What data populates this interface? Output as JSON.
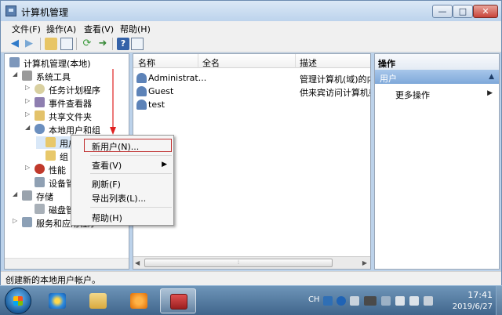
{
  "window": {
    "title": "计算机管理"
  },
  "window_controls": {
    "minimize": "—",
    "maximize": "□",
    "close": "✕"
  },
  "menu": [
    "文件(F)",
    "操作(A)",
    "查看(V)",
    "帮助(H)"
  ],
  "tree": {
    "items": [
      {
        "label": "计算机管理(本地)",
        "icon": "computer-management-icon"
      },
      {
        "label": "系统工具",
        "icon": "tools-icon"
      },
      {
        "label": "任务计划程序",
        "icon": "clock-icon"
      },
      {
        "label": "事件查看器",
        "icon": "event-viewer-icon"
      },
      {
        "label": "共享文件夹",
        "icon": "shared-folder-icon"
      },
      {
        "label": "本地用户和组",
        "icon": "users-group-icon"
      },
      {
        "label": "用户",
        "icon": "folder-icon"
      },
      {
        "label": "组",
        "icon": "folder-icon"
      },
      {
        "label": "性能",
        "icon": "performance-icon"
      },
      {
        "label": "设备管理器",
        "icon": "device-manager-icon"
      },
      {
        "label": "存储",
        "icon": "storage-icon"
      },
      {
        "label": "磁盘管理",
        "icon": "disk-icon"
      },
      {
        "label": "服务和应用程序",
        "icon": "services-icon"
      }
    ]
  },
  "list": {
    "columns": [
      "名称",
      "全名",
      "描述"
    ],
    "rows": [
      {
        "name": "Administrat...",
        "fullname": "",
        "desc": "管理计算机(域)的内置帐户"
      },
      {
        "name": "Guest",
        "fullname": "",
        "desc": "供来宾访问计算机或访问域的内置帐户"
      },
      {
        "name": "test",
        "fullname": "",
        "desc": ""
      }
    ]
  },
  "actions": {
    "header": "操作",
    "subheader": "用户",
    "more": "更多操作"
  },
  "context_menu": {
    "items": [
      "新用户(N)...",
      "查看(V)",
      "刷新(F)",
      "导出列表(L)...",
      "帮助(H)"
    ]
  },
  "status": {
    "text": "创建新的本地用户帐户。"
  },
  "taskbar": {
    "lang": "CH",
    "time": "17:41",
    "date": "2019/6/27"
  },
  "colors": {
    "annotation": "#e02020",
    "selection_header": "#7fa9da",
    "taskbar": "#40658b"
  }
}
